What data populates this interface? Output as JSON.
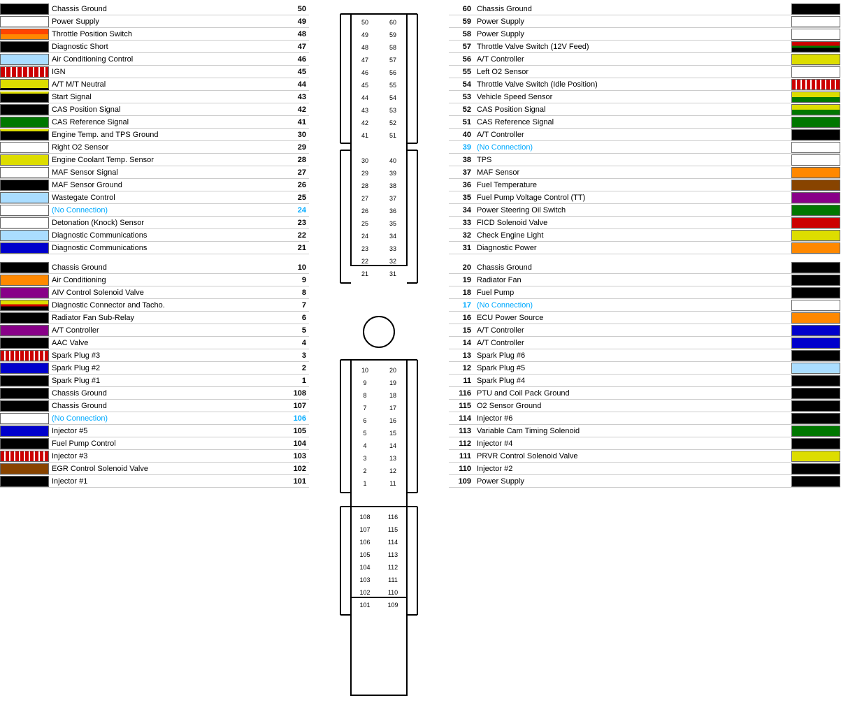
{
  "left_pins": [
    {
      "num": 50,
      "label": "Chassis Ground",
      "color": "#000000"
    },
    {
      "num": 49,
      "label": "Power Supply",
      "color": null
    },
    {
      "num": 48,
      "label": "Throttle Position Switch",
      "color": "#ff4400"
    },
    {
      "num": 47,
      "label": "Diagnostic Short",
      "color": "#000000"
    },
    {
      "num": 46,
      "label": "Air Conditioning Control",
      "color": "#aaddff"
    },
    {
      "num": 45,
      "label": "IGN",
      "color": "#cc0000"
    },
    {
      "num": 44,
      "label": "A/T M/T Neutral",
      "color": "#dddd00"
    },
    {
      "num": 43,
      "label": "Start Signal",
      "color": "#000000"
    },
    {
      "num": 42,
      "label": "CAS Position Signal",
      "color": "#000000"
    },
    {
      "num": 41,
      "label": "CAS Reference Signal",
      "color": "#007700"
    },
    {
      "num": 30,
      "label": "Engine Temp. and TPS Ground",
      "color": "#000000"
    },
    {
      "num": 29,
      "label": "Right O2 Sensor",
      "color": null
    },
    {
      "num": 28,
      "label": "Engine Coolant Temp. Sensor",
      "color": "#dddd00"
    },
    {
      "num": 27,
      "label": "MAF Sensor Signal",
      "color": null
    },
    {
      "num": 26,
      "label": "MAF Sensor Ground",
      "color": "#000000"
    },
    {
      "num": 25,
      "label": "Wastegate Control",
      "color": "#aaddff"
    },
    {
      "num": 24,
      "label": "(No Connection)",
      "color": null
    },
    {
      "num": 23,
      "label": "Detonation (Knock) Sensor",
      "color": null
    },
    {
      "num": 22,
      "label": "Diagnostic Communications",
      "color": "#aaddff"
    },
    {
      "num": 21,
      "label": "Diagnostic Communications",
      "color": "#0000cc"
    },
    {
      "num": "SPACE",
      "label": "",
      "color": null
    },
    {
      "num": 10,
      "label": "Chassis Ground",
      "color": "#000000"
    },
    {
      "num": 9,
      "label": "Air Conditioning",
      "color": "#ff8800"
    },
    {
      "num": 8,
      "label": "AIV Control Solenoid Valve",
      "color": "#880088"
    },
    {
      "num": 7,
      "label": "Diagnostic Connector and Tacho.",
      "color": "#dddd00"
    },
    {
      "num": 6,
      "label": "Radiator Fan Sub-Relay",
      "color": "#000000"
    },
    {
      "num": 5,
      "label": "A/T Controller",
      "color": "#880088"
    },
    {
      "num": 4,
      "label": "AAC Valve",
      "color": "#000000"
    },
    {
      "num": 3,
      "label": "Spark Plug #3",
      "color": "#cc0000"
    },
    {
      "num": 2,
      "label": "Spark Plug #2",
      "color": "#0000cc"
    },
    {
      "num": 1,
      "label": "Spark Plug #1",
      "color": "#000000"
    },
    {
      "num": 108,
      "label": "Chassis Ground",
      "color": "#000000"
    },
    {
      "num": 107,
      "label": "Chassis Ground",
      "color": "#000000"
    },
    {
      "num": 106,
      "label": "(No Connection)",
      "color": null
    },
    {
      "num": 105,
      "label": "Injector #5",
      "color": "#0000cc"
    },
    {
      "num": 104,
      "label": "Fuel Pump Control",
      "color": "#000000"
    },
    {
      "num": 103,
      "label": "Injector #3",
      "color": "#cc0000"
    },
    {
      "num": 102,
      "label": "EGR Control Solenoid Valve",
      "color": "#884400"
    },
    {
      "num": 101,
      "label": "Injector #1",
      "color": "#000000"
    }
  ],
  "right_pins": [
    {
      "num": 60,
      "label": "Chassis Ground",
      "color": "#000000"
    },
    {
      "num": 59,
      "label": "Power Supply",
      "color": null
    },
    {
      "num": 58,
      "label": "Power Supply",
      "color": null
    },
    {
      "num": 57,
      "label": "Throttle Valve Switch (12V Feed)",
      "color": "#cc0000"
    },
    {
      "num": 56,
      "label": "A/T Controller",
      "color": "#dddd00"
    },
    {
      "num": 55,
      "label": "Left O2 Sensor",
      "color": null
    },
    {
      "num": 54,
      "label": "Throttle Valve Switch (Idle Position)",
      "color": "#cc0000"
    },
    {
      "num": 53,
      "label": "Vehicle Speed Sensor",
      "color": "#dddd00"
    },
    {
      "num": 52,
      "label": "CAS Position Signal",
      "color": "#dddd00"
    },
    {
      "num": 51,
      "label": "CAS Reference Signal",
      "color": "#007700"
    },
    {
      "num": 40,
      "label": "A/T Controller",
      "color": "#000000"
    },
    {
      "num": 39,
      "label": "(No Connection)",
      "color": null,
      "no_conn": true
    },
    {
      "num": 38,
      "label": "TPS",
      "color": null
    },
    {
      "num": 37,
      "label": "MAF Sensor",
      "color": "#ff8800"
    },
    {
      "num": 36,
      "label": "Fuel Temperature",
      "color": "#884400"
    },
    {
      "num": 35,
      "label": "Fuel Pump Voltage Control (TT)",
      "color": "#880088"
    },
    {
      "num": 34,
      "label": "Power Steering Oil Switch",
      "color": "#007700"
    },
    {
      "num": 33,
      "label": "FICD Solenoid Valve",
      "color": "#cc0000"
    },
    {
      "num": 32,
      "label": "Check Engine Light",
      "color": "#dddd00"
    },
    {
      "num": 31,
      "label": "Diagnostic Power",
      "color": "#ff8800"
    },
    {
      "num": "SPACE",
      "label": "",
      "color": null
    },
    {
      "num": 20,
      "label": "Chassis Ground",
      "color": "#000000"
    },
    {
      "num": 19,
      "label": "Radiator Fan",
      "color": "#000000"
    },
    {
      "num": 18,
      "label": "Fuel Pump",
      "color": "#000000"
    },
    {
      "num": 17,
      "label": "(No Connection)",
      "color": null,
      "no_conn": true
    },
    {
      "num": 16,
      "label": "ECU Power Source",
      "color": "#ff8800"
    },
    {
      "num": 15,
      "label": "A/T Controller",
      "color": "#0000cc"
    },
    {
      "num": 14,
      "label": "A/T Controller",
      "color": "#0000cc"
    },
    {
      "num": 13,
      "label": "Spark Plug #6",
      "color": "#000000"
    },
    {
      "num": 12,
      "label": "Spark Plug #5",
      "color": "#aaddff"
    },
    {
      "num": 11,
      "label": "Spark Plug #4",
      "color": "#000000"
    },
    {
      "num": 116,
      "label": "PTU and Coil Pack Ground",
      "color": "#000000"
    },
    {
      "num": 115,
      "label": "O2 Sensor Ground",
      "color": "#000000"
    },
    {
      "num": 114,
      "label": "Injector #6",
      "color": "#000000"
    },
    {
      "num": 113,
      "label": "Variable Cam Timing Solenoid",
      "color": "#007700"
    },
    {
      "num": 112,
      "label": "Injector #4",
      "color": "#000000"
    },
    {
      "num": 111,
      "label": "PRVR Control Solenoid Valve",
      "color": "#dddd00"
    },
    {
      "num": 110,
      "label": "Injector #2",
      "color": "#000000"
    },
    {
      "num": 109,
      "label": "Power Supply",
      "color": "#000000"
    }
  ],
  "connector": {
    "top_pairs": [
      [
        50,
        60
      ],
      [
        49,
        59
      ],
      [
        48,
        58
      ],
      [
        47,
        57
      ],
      [
        46,
        56
      ],
      [
        45,
        55
      ],
      [
        44,
        54
      ],
      [
        43,
        53
      ],
      [
        42,
        52
      ],
      [
        41,
        51
      ],
      [
        30,
        40
      ],
      [
        29,
        39
      ],
      [
        28,
        38
      ],
      [
        27,
        37
      ],
      [
        26,
        36
      ],
      [
        25,
        35
      ],
      [
        24,
        34
      ],
      [
        23,
        33
      ],
      [
        22,
        32
      ],
      [
        21,
        31
      ]
    ],
    "bottom_pairs": [
      [
        10,
        20
      ],
      [
        9,
        19
      ],
      [
        8,
        18
      ],
      [
        7,
        17
      ],
      [
        6,
        16
      ],
      [
        5,
        15
      ],
      [
        4,
        14
      ],
      [
        3,
        13
      ],
      [
        2,
        12
      ],
      [
        1,
        11
      ],
      [
        108,
        116
      ],
      [
        107,
        115
      ],
      [
        106,
        114
      ],
      [
        105,
        113
      ],
      [
        104,
        112
      ],
      [
        103,
        111
      ],
      [
        102,
        110
      ],
      [
        101,
        109
      ]
    ]
  }
}
